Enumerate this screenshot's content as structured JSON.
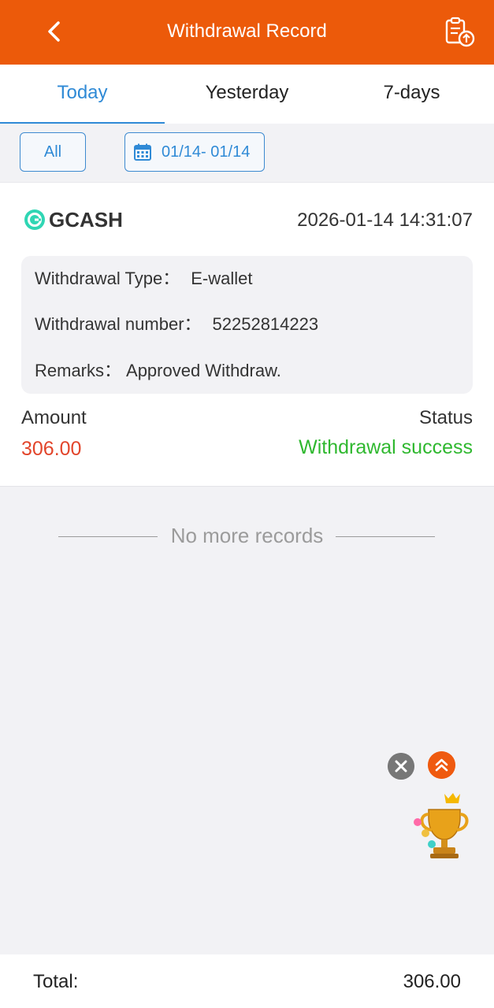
{
  "header": {
    "title": "Withdrawal Record",
    "back_icon": "chevron-left-icon",
    "action_icon": "clipboard-upload-icon",
    "background": "#ec5a0a"
  },
  "tabs": [
    {
      "label": "Today",
      "active": true
    },
    {
      "label": "Yesterday",
      "active": false
    },
    {
      "label": "7-days",
      "active": false
    }
  ],
  "filters": {
    "all_label": "All",
    "date_range": "01/14- 01/14",
    "date_icon": "calendar-icon"
  },
  "record": {
    "method": "GCASH",
    "method_icon": "gcash-logo-icon",
    "datetime": "2026-01-14 14:31:07",
    "type_label": "Withdrawal Type：",
    "type_value": "E-wallet",
    "number_label": "Withdrawal number：",
    "number_value": "52252814223",
    "remarks_label": "Remarks：",
    "remarks_value": "Approved Withdraw.",
    "amount_label": "Amount",
    "amount_value": "306.00",
    "status_label": "Status",
    "status_value": "Withdrawal success",
    "amount_color": "#e2452b",
    "status_color": "#2fb82f"
  },
  "list_end_text": "No more records",
  "floating": {
    "close_icon": "close-icon",
    "up_icon": "double-chevron-up-icon",
    "trophy_icon": "trophy-icon"
  },
  "footer": {
    "total_label": "Total:",
    "total_value": "306.00"
  }
}
